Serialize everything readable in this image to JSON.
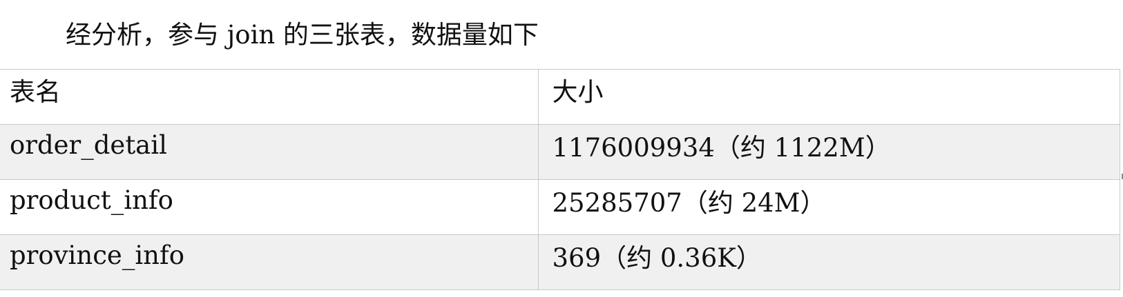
{
  "intro": {
    "text": "经分析，参与 join 的三张表，数据量如下"
  },
  "table": {
    "headers": {
      "name": "表名",
      "size": "大小"
    },
    "rows": [
      {
        "name": "order_detail",
        "size": "1176009934（约 1122M）"
      },
      {
        "name": "product_info",
        "size": "25285707（约 24M）"
      },
      {
        "name": "province_info",
        "size": "369（约 0.36K）"
      }
    ]
  }
}
